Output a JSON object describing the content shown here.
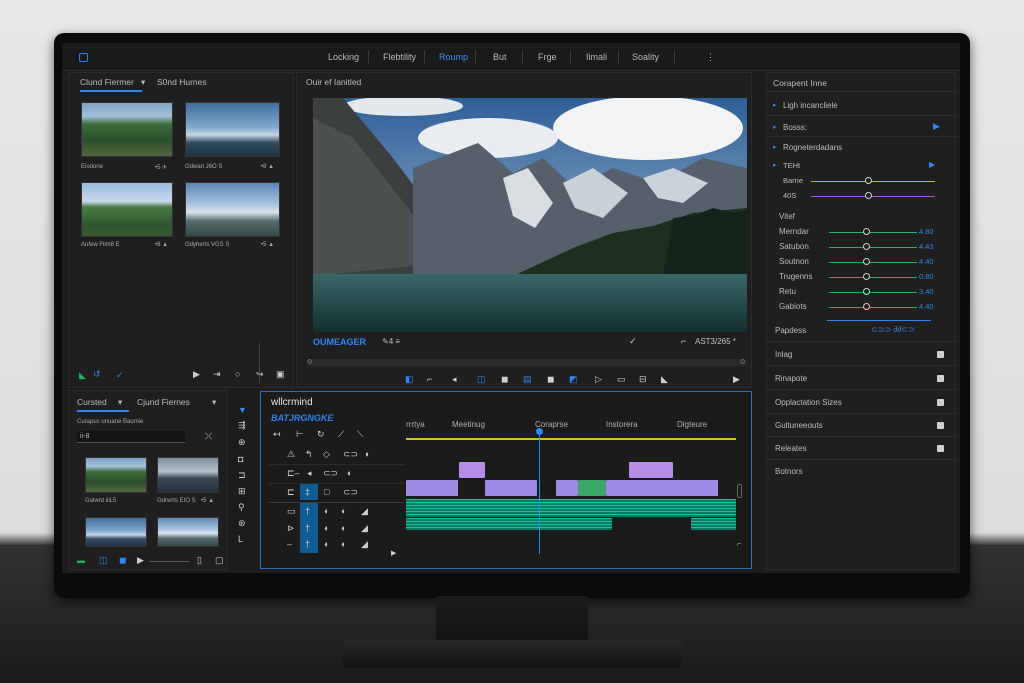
{
  "menubar": {
    "items": [
      "Locking",
      "Flebtility",
      "Roump",
      "But",
      "Frge",
      "Iimali",
      "Soality"
    ],
    "active_index": 2,
    "more": "⋮"
  },
  "source_panel": {
    "tabs": [
      "Clund Fiermer",
      "S0nd Hurnes"
    ],
    "dropdown": "▾",
    "clips": [
      {
        "label": "Eiodone",
        "meta": "•5 ✈"
      },
      {
        "label": "Gdwarl J6O S",
        "meta": "•8 ▲"
      },
      {
        "label": "Aufew Flim8 E",
        "meta": "•8 ▲"
      },
      {
        "label": "Gdyherts VGS S",
        "meta": "•5 ▲"
      }
    ]
  },
  "program_monitor": {
    "title": "Ouir ef Ianitled",
    "label": "OUMEAGER",
    "timecode": "AST3/265 *",
    "left_glyphs": "✎4  ≡"
  },
  "effects_panel": {
    "title": "Corapent Inne",
    "items": [
      {
        "label": "Ligh incancliele"
      },
      {
        "label": "Bosss:"
      },
      {
        "label": "Rogneterdadans"
      }
    ],
    "subsection": "TEHt",
    "top_sliders": [
      {
        "label": "Barne",
        "color": "#8bd02a",
        "value": 0.5
      },
      {
        "label": "40S",
        "color": "#b25bf2",
        "value": 0.5
      }
    ],
    "group": "Vitef",
    "sliders": [
      {
        "label": "Merndar",
        "value": "4.80"
      },
      {
        "label": "Satubon",
        "value": "4.43"
      },
      {
        "label": "Soutnon",
        "value": "4.40"
      },
      {
        "label": "Trugenns",
        "value": "0.80"
      },
      {
        "label": "Retu",
        "value": "3.40"
      },
      {
        "label": "Gabiots",
        "value": "4.40"
      }
    ],
    "footer_label": "Papdess",
    "footer_glyphs": "⊂⊃⊃  ∂∂⊂⊃",
    "accordion": [
      "Inlag",
      "Rinapote",
      "Opplactation Sizes",
      "Gultuneeouts",
      "Releates",
      "Botnors"
    ]
  },
  "project_panel": {
    "tabs": [
      "Cursted",
      "Cjund Fiernes"
    ],
    "hint": "Curapus unuane Baumie",
    "search_value": "ii-8",
    "clips": [
      {
        "label": "Galwrd iiiL5",
        "meta": "•5 ▲"
      },
      {
        "label": "Gdrwrts EIO S",
        "meta": "•5 ▲"
      }
    ]
  },
  "timeline": {
    "title": "wllcrmind",
    "sequence": "BATJRGNGKE",
    "ruler": [
      "rrrtya",
      "Meetinug",
      "Coraprse",
      "Instorera",
      "Digteure"
    ]
  },
  "colors": {
    "accent": "#2f86f2",
    "video_clip": "#9f8be6",
    "audio_clip": "#14c39a",
    "playhead": "#1f8ef1",
    "work_area": "#d3c41c"
  }
}
